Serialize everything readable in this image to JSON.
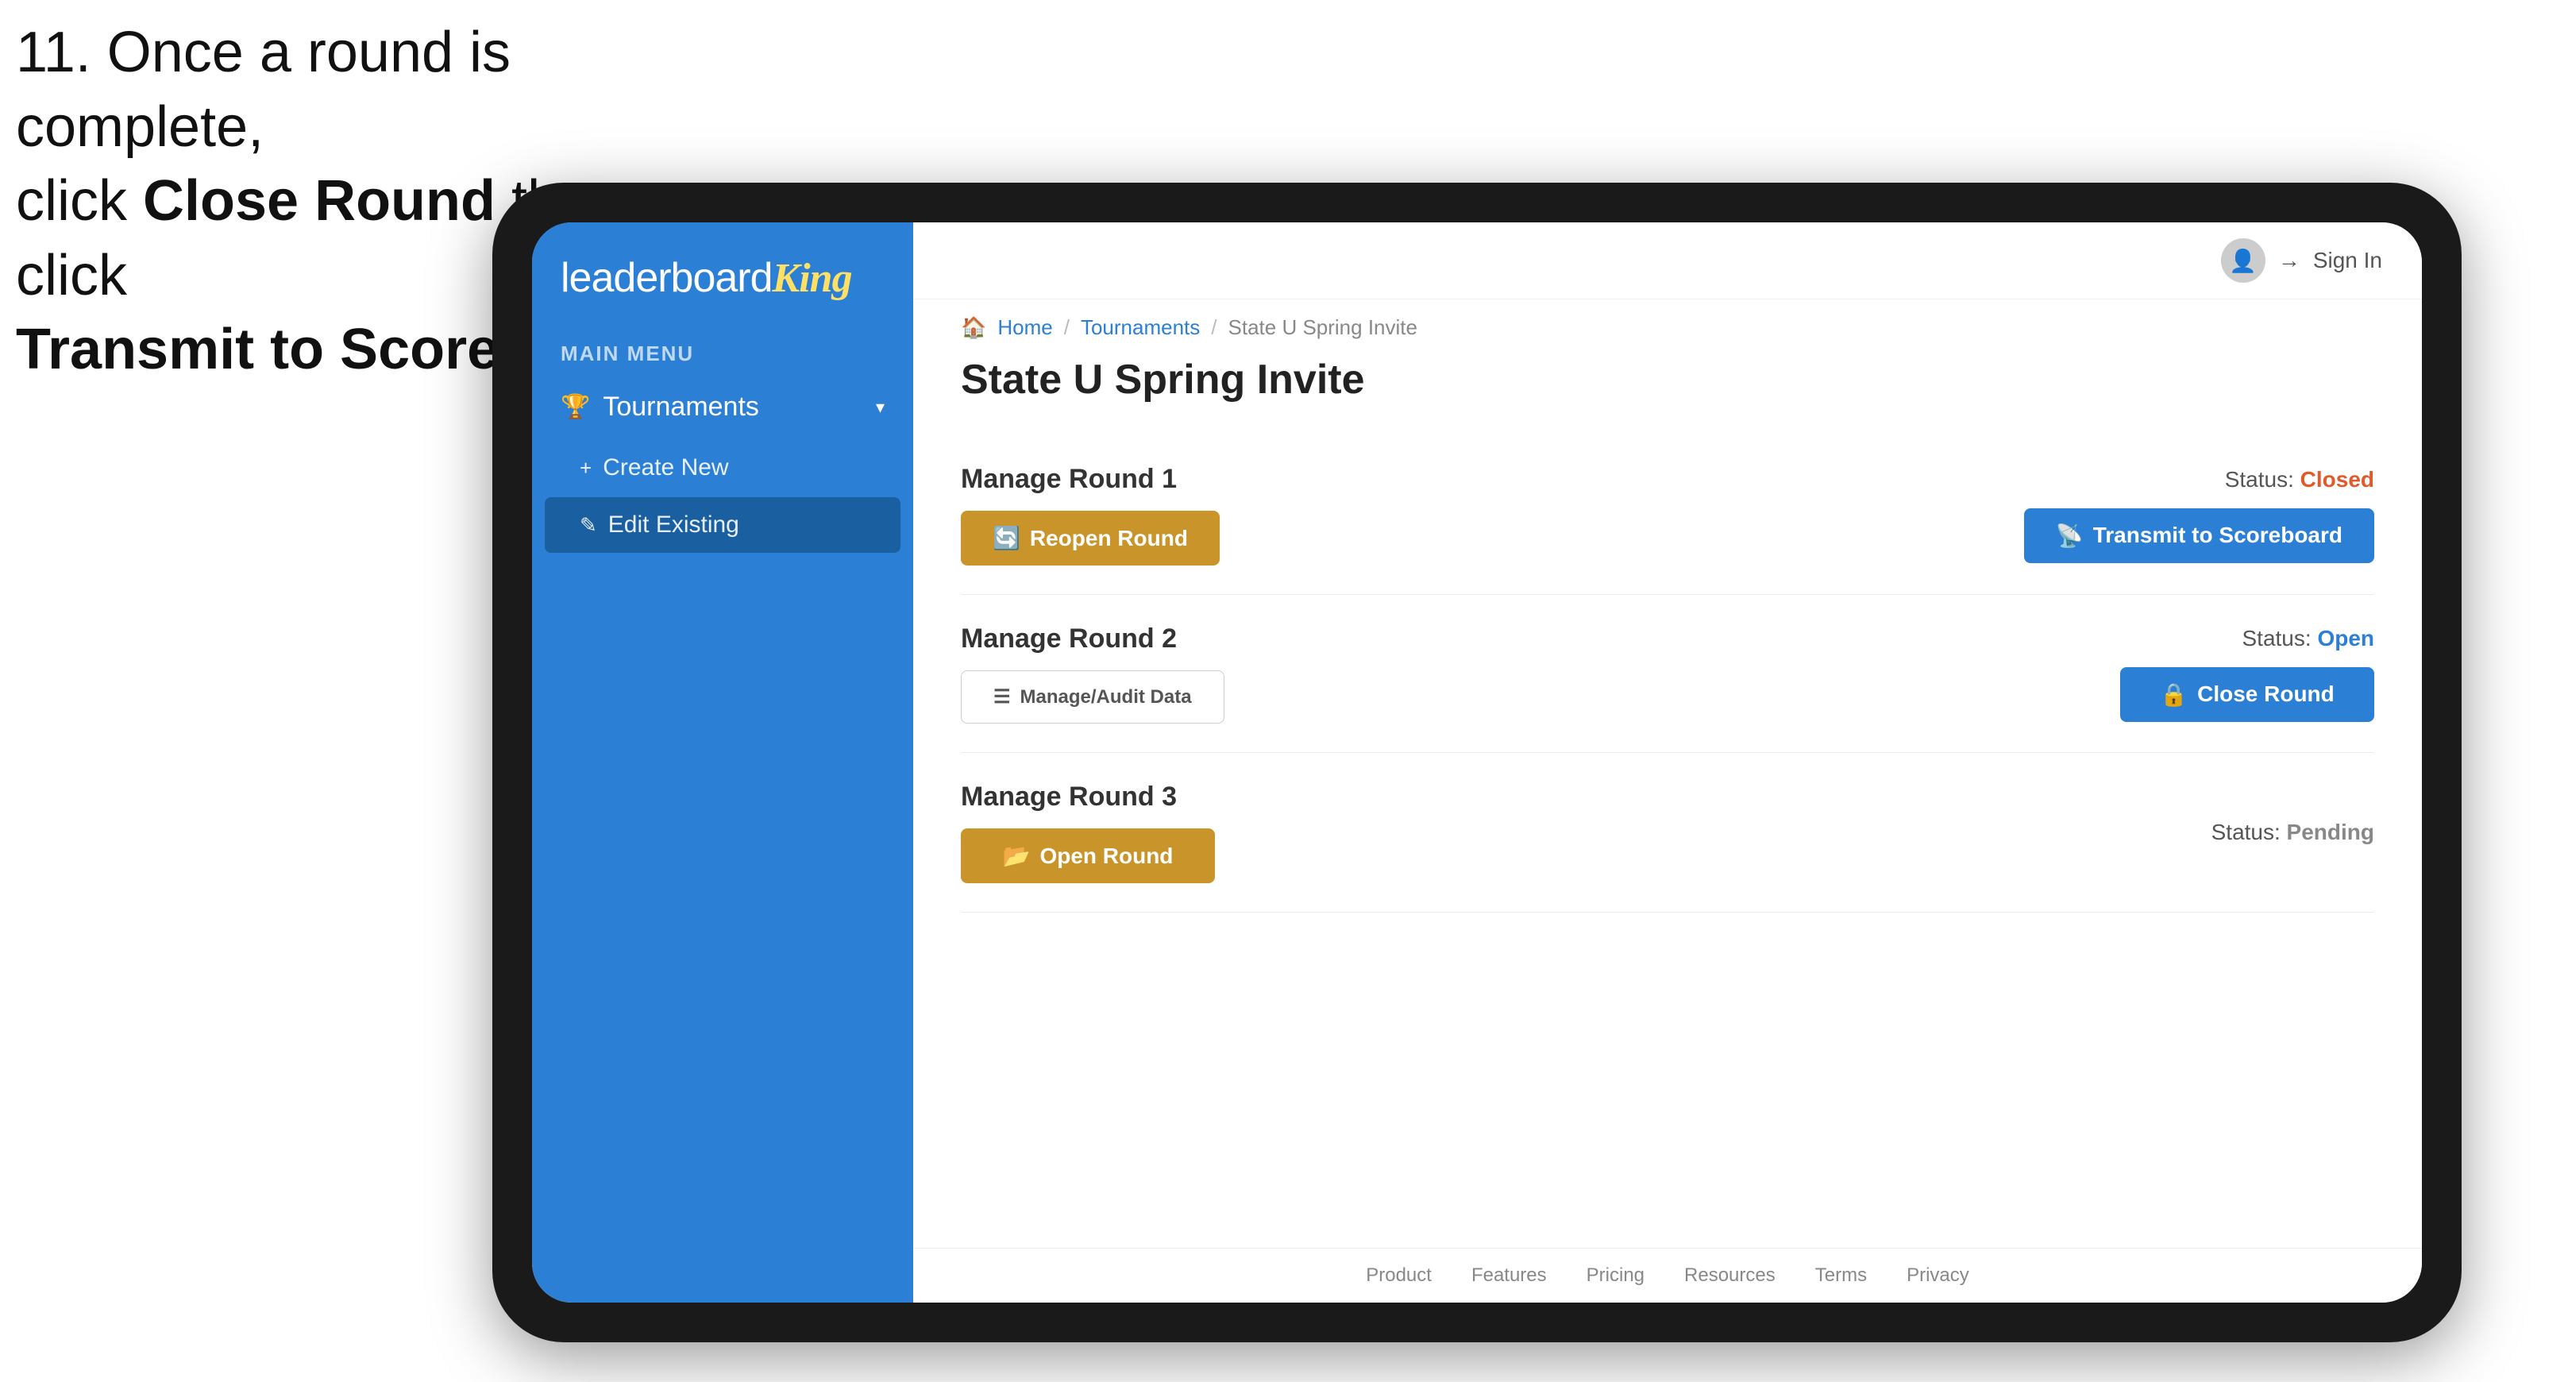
{
  "instruction": {
    "line1": "11. Once a round is complete,",
    "line2": "click ",
    "bold1": "Close Round",
    "line3": " then click",
    "bold2": "Transmit to Scoreboard."
  },
  "logo": {
    "text_before": "leaderboard",
    "text_highlight": "King"
  },
  "sidebar": {
    "main_menu_label": "MAIN MENU",
    "tournaments_label": "Tournaments",
    "create_new_label": "Create New",
    "edit_existing_label": "Edit Existing"
  },
  "topbar": {
    "sign_in_label": "Sign In"
  },
  "breadcrumb": {
    "home": "Home",
    "separator1": "/",
    "tournaments": "Tournaments",
    "separator2": "/",
    "current": "State U Spring Invite"
  },
  "page": {
    "title": "State U Spring Invite",
    "rounds": [
      {
        "id": "round1",
        "title": "Manage Round 1",
        "status_label": "Status:",
        "status_value": "Closed",
        "status_type": "closed",
        "primary_button": "Reopen Round",
        "primary_button_type": "gold",
        "secondary_button": "Transmit to Scoreboard",
        "secondary_button_type": "blue"
      },
      {
        "id": "round2",
        "title": "Manage Round 2",
        "status_label": "Status:",
        "status_value": "Open",
        "status_type": "open",
        "primary_button": "Manage/Audit Data",
        "primary_button_type": "outline",
        "secondary_button": "Close Round",
        "secondary_button_type": "blue"
      },
      {
        "id": "round3",
        "title": "Manage Round 3",
        "status_label": "Status:",
        "status_value": "Pending",
        "status_type": "pending",
        "primary_button": "Open Round",
        "primary_button_type": "gold"
      }
    ]
  },
  "footer": {
    "links": [
      "Product",
      "Features",
      "Pricing",
      "Resources",
      "Terms",
      "Privacy"
    ]
  }
}
